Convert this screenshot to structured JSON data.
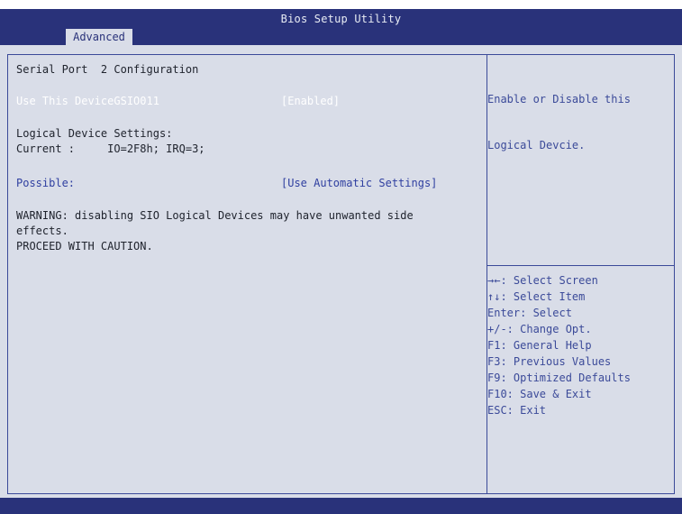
{
  "header": {
    "title": "Bios Setup Utility",
    "tab": "Advanced"
  },
  "main": {
    "section_title": "Serial Port  2 Configuration",
    "use_device_label": "Use This DeviceGSIO011",
    "use_device_value": "[Enabled]",
    "logical_settings_label": "Logical Device Settings:",
    "current_line": "Current :     IO=2F8h; IRQ=3;",
    "possible_label": "Possible:",
    "possible_value": "[Use Automatic Settings]",
    "warning_line1": "WARNING: disabling SIO Logical Devices may have unwanted side",
    "warning_line2": "effects.",
    "warning_line3": "PROCEED WITH CAUTION."
  },
  "help": {
    "line1": "Enable or Disable this",
    "line2": "Logical Devcie."
  },
  "keys": [
    "→←: Select Screen",
    "↑↓: Select Item",
    "Enter: Select",
    "+/-: Change Opt.",
    "F1: General Help",
    "F3: Previous Values",
    "F9: Optimized Defaults",
    "F10: Save & Exit",
    "ESC: Exit"
  ],
  "colors": {
    "header_bg": "#29327a",
    "panel_bg": "#d9dde8",
    "highlight_text": "#ffffff",
    "option_text": "#2f3fa0"
  }
}
